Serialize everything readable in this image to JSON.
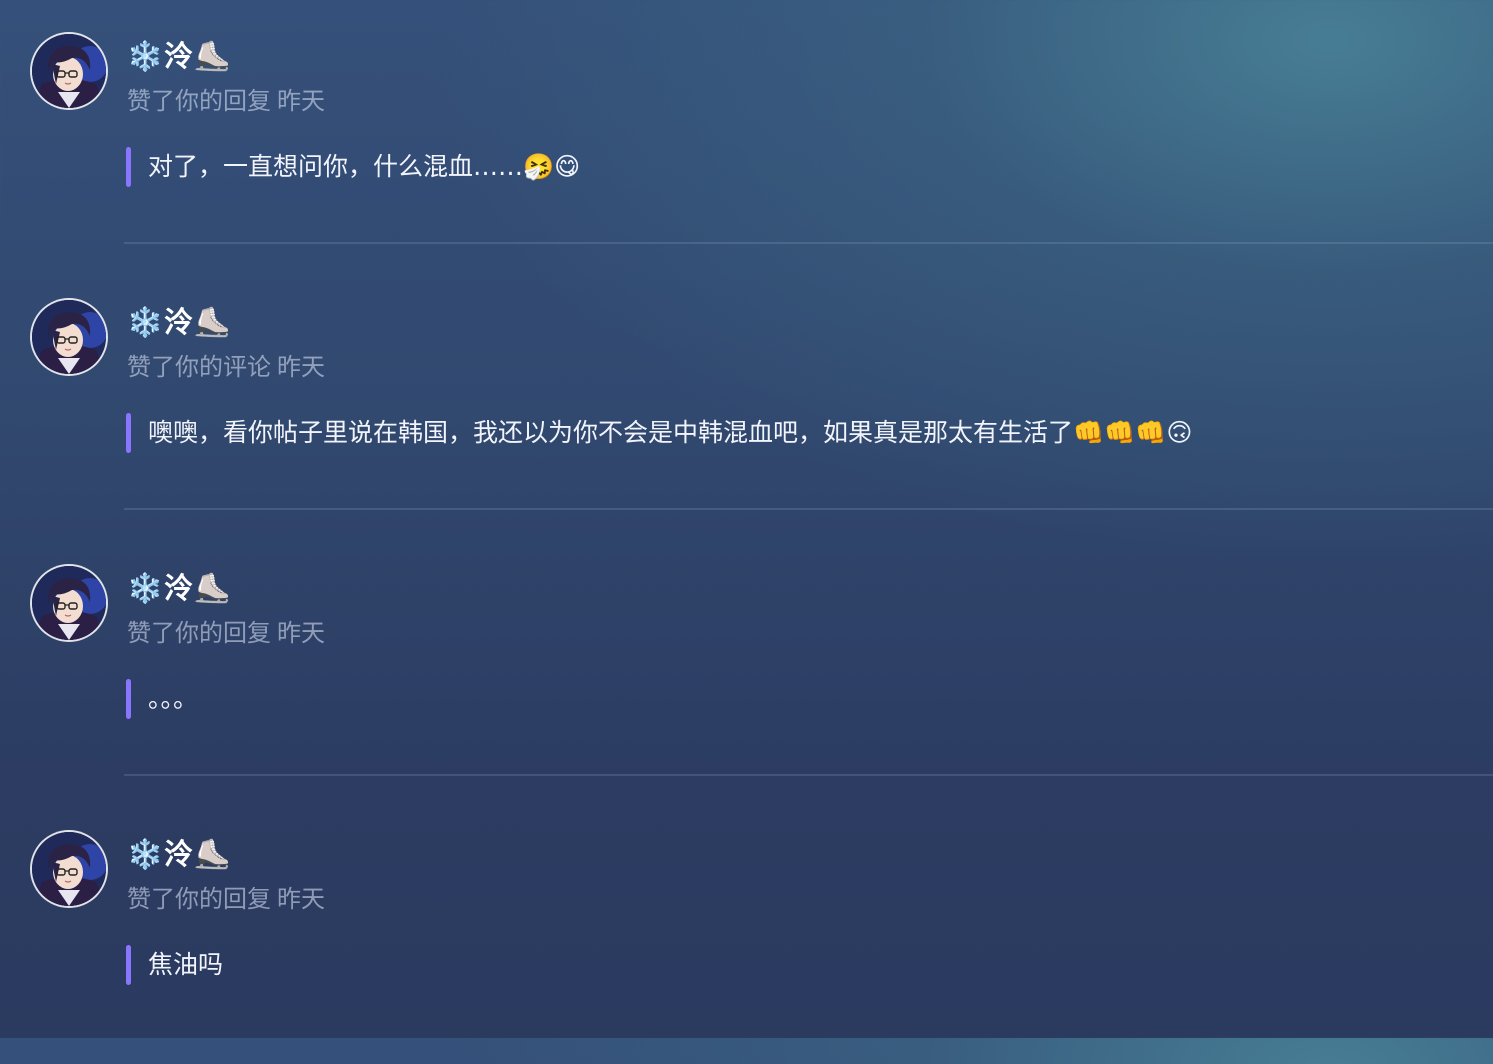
{
  "notifications": [
    {
      "username": "❄️泠⛸️",
      "action": "赞了你的回复",
      "time": "昨天",
      "quote": "对了，一直想问你，什么混血……🤧😋"
    },
    {
      "username": "❄️泠⛸️",
      "action": "赞了你的评论",
      "time": "昨天",
      "quote": "噢噢，看你帖子里说在韩国，我还以为你不会是中韩混血吧，如果真是那太有生活了👊👊👊🙃"
    },
    {
      "username": "❄️泠⛸️",
      "action": "赞了你的回复",
      "time": "昨天",
      "quote": "。。。"
    },
    {
      "username": "❄️泠⛸️",
      "action": "赞了你的回复",
      "time": "昨天",
      "quote": "焦油吗"
    }
  ],
  "colors": {
    "quote_bar": "#8a75ff",
    "username": "#ffffff",
    "meta": "#cdd7eb"
  },
  "icons": {
    "avatar": "anime-avatar-icon"
  }
}
